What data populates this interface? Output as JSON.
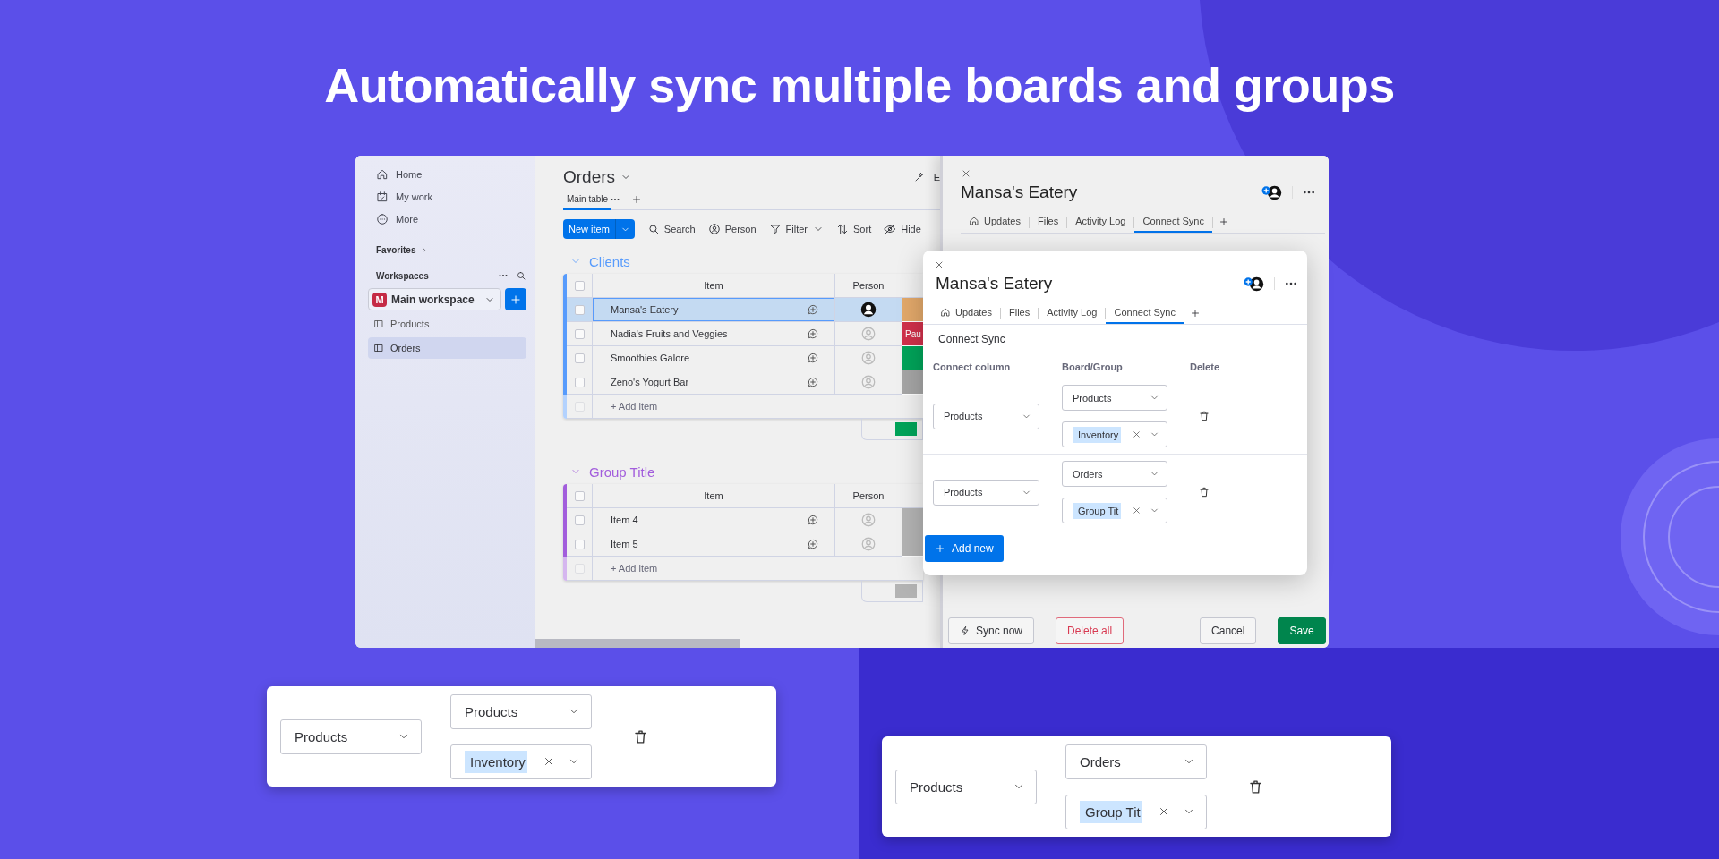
{
  "headline": "Automatically sync multiple boards and groups",
  "sidebar": {
    "nav": [
      {
        "label": "Home",
        "kind": "home"
      },
      {
        "label": "My work",
        "kind": "calendar"
      },
      {
        "label": "More",
        "kind": "more"
      }
    ],
    "favorites": "Favorites",
    "workspaces": "Workspaces",
    "workspace": "Main workspace",
    "workspace_badge": "M",
    "boards": [
      {
        "label": "Products",
        "selected": false
      },
      {
        "label": "Orders",
        "selected": true
      }
    ]
  },
  "board": {
    "title": "Orders",
    "view_tab": "Main table",
    "cut_label": "E",
    "new_item": "New item",
    "actions": [
      {
        "label": "Search",
        "kind": "search"
      },
      {
        "label": "Person",
        "kind": "person"
      },
      {
        "label": "Filter",
        "kind": "filter"
      },
      {
        "label": "Sort",
        "kind": "sort"
      },
      {
        "label": "Hide",
        "kind": "hide"
      }
    ],
    "groups": [
      {
        "title": "Clients",
        "color": "#579bfc",
        "all_checked": false,
        "add_checked": false,
        "item_header": "Item",
        "person_header": "Person",
        "add_item": "+ Add item",
        "summary": {
          "color": "#00a359"
        },
        "rows": [
          {
            "name": "Mansa's Eatery",
            "selected": true,
            "checked": false,
            "assigned": true,
            "color": "#e2a86a"
          },
          {
            "name": "Nadia's Fruits and Veggies",
            "selected": false,
            "checked": false,
            "assigned": false,
            "color": "#d0304a",
            "status": "Pau"
          },
          {
            "name": "Smoothies Galore",
            "selected": false,
            "checked": false,
            "assigned": false,
            "color": "#00a359"
          },
          {
            "name": "Zeno's Yogurt Bar",
            "selected": false,
            "checked": false,
            "assigned": false,
            "color": "#a5a5a5"
          }
        ]
      },
      {
        "title": "Group Title",
        "color": "#a25ddc",
        "all_checked": false,
        "add_checked": false,
        "item_header": "Item",
        "person_header": "Person",
        "add_item": "+ Add item",
        "summary": {
          "color": "#b3b3b3"
        },
        "rows": [
          {
            "name": "Item 4",
            "selected": false,
            "checked": false,
            "assigned": false,
            "color": "#b3b3b3"
          },
          {
            "name": "Item 5",
            "selected": false,
            "checked": false,
            "assigned": false,
            "color": "#b3b3b3"
          }
        ]
      }
    ]
  },
  "panel": {
    "title": "Mansa's Eatery",
    "tabs": [
      {
        "label": "Updates",
        "kind": "home",
        "selected": false
      },
      {
        "label": "Files",
        "selected": false
      },
      {
        "label": "Activity Log",
        "selected": false
      },
      {
        "label": "Connect Sync",
        "selected": true
      }
    ],
    "buttons": [
      {
        "label": "Sync now",
        "kind": "sync"
      },
      {
        "label": "Delete all",
        "kind": "danger"
      },
      {
        "label": "Cancel",
        "kind": "secondary"
      },
      {
        "label": "Save",
        "kind": "primary"
      }
    ]
  },
  "popup": {
    "title": "Mansa's Eatery",
    "tabs": [
      {
        "label": "Updates",
        "kind": "home",
        "selected": false
      },
      {
        "label": "Files",
        "selected": false
      },
      {
        "label": "Activity Log",
        "selected": false
      },
      {
        "label": "Connect Sync",
        "selected": true
      }
    ],
    "section": "Connect Sync",
    "columns": [
      "Connect column",
      "Board/Group",
      "Delete"
    ],
    "rows": [
      {
        "column": "Products",
        "board": "Products",
        "group": "Inventory"
      },
      {
        "column": "Products",
        "board": "Orders",
        "group": "Group Tit"
      }
    ],
    "add_button": "Add new"
  },
  "zoom_cards": [
    {
      "column": "Products",
      "board": "Products",
      "group": "Inventory"
    },
    {
      "column": "Products",
      "board": "Orders",
      "group": "Group Tit"
    }
  ]
}
